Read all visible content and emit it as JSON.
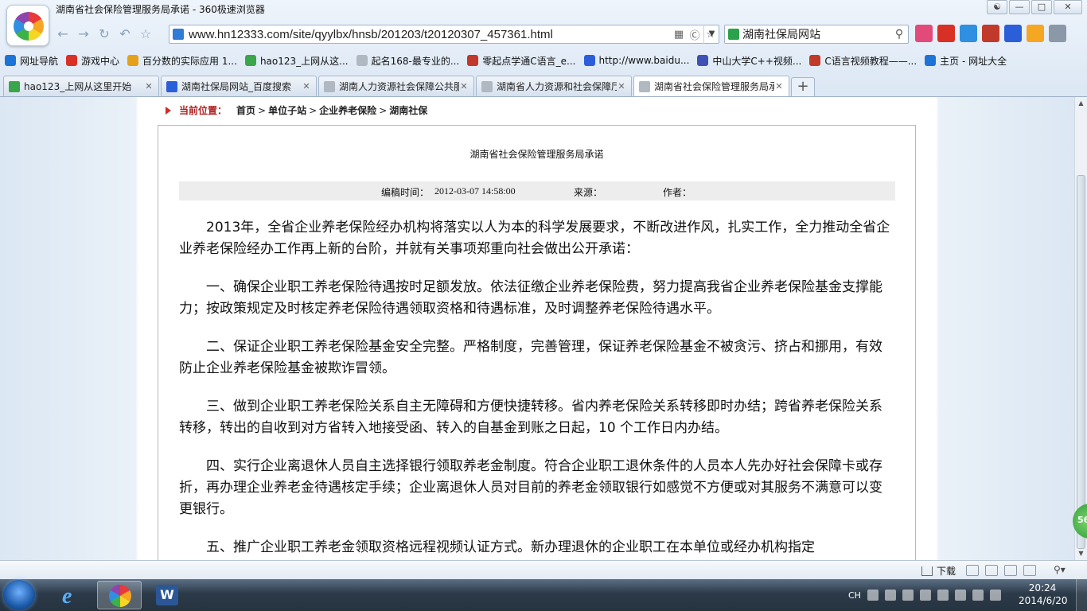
{
  "window": {
    "title": "湖南省社会保险管理服务局承诺 - 360极速浏览器",
    "controls": [
      "—",
      "□",
      "✕"
    ]
  },
  "address": {
    "url": "www.hn12333.com/site/qyylbx/hnsb/201203/t20120307_457361.html"
  },
  "search": {
    "value": "湖南社保局网站"
  },
  "bookmarks": [
    {
      "label": "网址导航",
      "color": "#1e73d8"
    },
    {
      "label": "游戏中心",
      "color": "#d93025"
    },
    {
      "label": "百分数的实际应用 1...",
      "color": "#e4a11b"
    },
    {
      "label": "hao123_上网从这...",
      "color": "#3aa64b"
    },
    {
      "label": "起名168-最专业的...",
      "color": "#b0b8c2"
    },
    {
      "label": "零起点学通C语言_e...",
      "color": "#c0392b"
    },
    {
      "label": "http://www.baidu...",
      "color": "#2b5fd9"
    },
    {
      "label": "中山大学C++视频...",
      "color": "#3f51b5"
    },
    {
      "label": "C语言视频教程——...",
      "color": "#c0392b"
    },
    {
      "label": "主页 - 网址大全",
      "color": "#1e73d8"
    }
  ],
  "tabs": [
    {
      "label": "hao123_上网从这里开始",
      "color": "#3aa64b",
      "active": false
    },
    {
      "label": "湖南社保局网站_百度搜索",
      "color": "#2b5fd9",
      "active": false
    },
    {
      "label": "湖南人力资源社会保障公共服",
      "color": "#b0b8c2",
      "active": false
    },
    {
      "label": "湖南省人力资源和社会保障厅",
      "color": "#b0b8c2",
      "active": false
    },
    {
      "label": "湖南省社会保险管理服务局承",
      "color": "#b0b8c2",
      "active": true
    }
  ],
  "breadcrumb": {
    "label": "当前位置：",
    "items": [
      "首页",
      "单位子站",
      "企业养老保险",
      "湖南社保"
    ],
    "separator": ">"
  },
  "article": {
    "title": "湖南省社会保险管理服务局承诺",
    "meta": {
      "time_label": "编稿时间：",
      "time": "2012-03-07 14:58:00",
      "source_label": "来源：",
      "author_label": "作者："
    },
    "paragraphs": [
      "2013年，全省企业养老保险经办机构将落实以人为本的科学发展要求，不断改进作风，扎实工作，全力推动全省企业养老保险经办工作再上新的台阶，并就有关事项郑重向社会做出公开承诺：",
      "一、确保企业职工养老保险待遇按时足额发放。依法征缴企业养老保险费，努力提高我省企业养老保险基金支撑能力；按政策规定及时核定养老保险待遇领取资格和待遇标准，及时调整养老保险待遇水平。",
      "二、保证企业职工养老保险基金安全完整。严格制度，完善管理，保证养老保险基金不被贪污、挤占和挪用，有效防止企业养老保险基金被欺诈冒领。",
      "三、做到企业职工养老保险关系自主无障碍和方便快捷转移。省内养老保险关系转移即时办结；跨省养老保险关系转移，转出的自收到对方省转入地接受函、转入的自基金到账之日起，10 个工作日内办结。",
      "四、实行企业离退休人员自主选择银行领取养老金制度。符合企业职工退休条件的人员本人先办好社会保障卡或存折，再办理企业养老金待遇核定手续；企业离退休人员对目前的养老金领取银行如感觉不方便或对其服务不满意可以变更银行。",
      "五、推广企业职工养老金领取资格远程视频认证方式。新办理退休的企业职工在本单位或经办机构指定"
    ]
  },
  "float_badge": "56",
  "status_bar": {
    "download_label": "下载"
  },
  "taskbar": {
    "word_glyph": "W",
    "tray_lang": "CH",
    "clock_time": "20:24",
    "clock_date": "2014/6/20"
  }
}
